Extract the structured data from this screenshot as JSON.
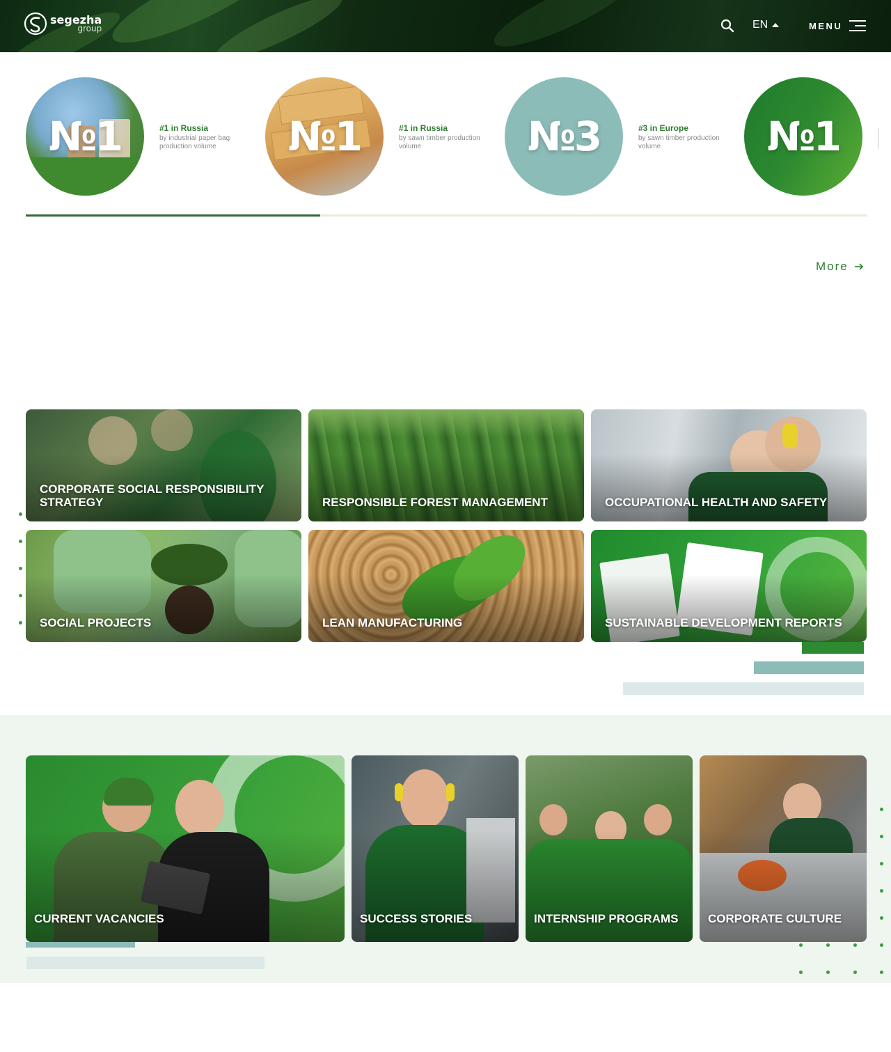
{
  "header": {
    "logo_name": "segezha",
    "logo_sub": "group",
    "lang": "EN",
    "menu_label": "MENU"
  },
  "rankings": [
    {
      "number": "№1",
      "title": "#1 in Russia",
      "desc": "by industrial paper bag production volume"
    },
    {
      "number": "№1",
      "title": "#1 in Russia",
      "desc": "by sawn timber production volume"
    },
    {
      "number": "№3",
      "title": "#3 in Europe",
      "desc": "by sawn timber production volume"
    },
    {
      "number": "№1",
      "title": "",
      "desc": ""
    }
  ],
  "slider_progress": 0.35,
  "more_label": "More",
  "sustainability_tiles": [
    {
      "label": "CORPORATE SOCIAL RESPONSIBILITY STRATEGY"
    },
    {
      "label": "RESPONSIBLE FOREST MANAGEMENT"
    },
    {
      "label": "OCCUPATIONAL HEALTH AND SAFETY"
    },
    {
      "label": "SOCIAL PROJECTS"
    },
    {
      "label": "LEAN MANUFACTURING"
    },
    {
      "label": "SUSTAINABLE DEVELOPMENT REPORTS"
    }
  ],
  "career_tiles": [
    {
      "label": "CURRENT VACANCIES"
    },
    {
      "label": "SUCCESS STORIES"
    },
    {
      "label": "INTERNSHIP PROGRAMS"
    },
    {
      "label": "CORPORATE CULTURE"
    }
  ],
  "colors": {
    "brand_green": "#2e7d32",
    "accent_teal": "#8cbcb8",
    "light_teal": "#dce9e8",
    "career_bg": "#eff5ef"
  },
  "icons": [
    "search-icon",
    "caret-up-icon",
    "menu-icon",
    "arrow-right-icon",
    "segezha-logo-icon"
  ]
}
